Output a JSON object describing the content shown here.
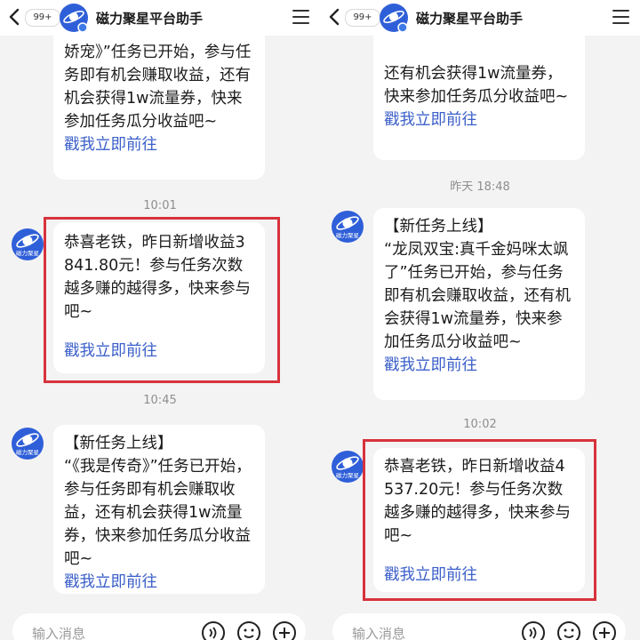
{
  "header": {
    "badge": "99+",
    "title": "磁力聚星平台助手"
  },
  "avatar_label": "磁力聚星",
  "input": {
    "placeholder": "输入消息"
  },
  "left": {
    "msg1": {
      "text": "娇宠》”任务已开始，参与任务即有机会赚取收益，还有机会获得1w流量券，快来参加任务瓜分收益吧~",
      "link": "戳我立即前往"
    },
    "time1": "10:01",
    "msg2": {
      "text": "恭喜老铁，昨日新增收益3841.80元！参与任务次数越多赚的越得多，快来参与吧~",
      "link": "戳我立即前往"
    },
    "time2": "10:45",
    "msg3": {
      "text": "【新任务上线】\n“《我是传奇》”任务已开始，参与任务即有机会赚取收益，还有机会获得1w流量券，快来参加任务瓜分收益吧~",
      "link": "戳我立即前往"
    }
  },
  "right": {
    "msg1": {
      "text": "还有机会获得1w流量券，快来参加任务瓜分收益吧~",
      "link": "戳我立即前往"
    },
    "time1": "昨天 18:48",
    "msg2": {
      "text": "【新任务上线】\n“龙凤双宝:真千金妈咪太飒了”任务已开始，参与任务即有机会赚取收益，还有机会获得1w流量券，快来参加任务瓜分收益吧~",
      "link": "戳我立即前往"
    },
    "time2": "10:02",
    "msg3": {
      "text": "恭喜老铁，昨日新增收益4537.20元！参与任务次数越多赚的越得多，快来参与吧~",
      "link": "戳我立即前往"
    }
  },
  "icons": [
    "back-icon",
    "menu-icon",
    "voice-icon",
    "emoji-icon",
    "plus-icon"
  ],
  "colors": {
    "link": "#3b5fc9",
    "highlight_box": "#d8323c",
    "avatar": "#2f5fd8"
  }
}
